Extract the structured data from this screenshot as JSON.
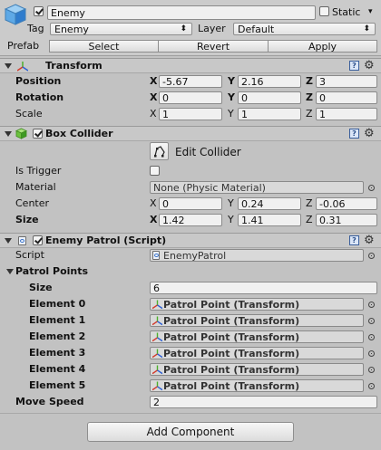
{
  "object": {
    "active": true,
    "name": "Enemy",
    "static_label": "Static",
    "static_checked": false,
    "tag_label": "Tag",
    "tag_value": "Enemy",
    "layer_label": "Layer",
    "layer_value": "Default",
    "prefab_label": "Prefab",
    "prefab_buttons": {
      "select": "Select",
      "revert": "Revert",
      "apply": "Apply"
    }
  },
  "transform": {
    "title": "Transform",
    "position_label": "Position",
    "rotation_label": "Rotation",
    "scale_label": "Scale",
    "axis": {
      "x": "X",
      "y": "Y",
      "z": "Z"
    },
    "position": {
      "x": "-5.67",
      "y": "2.16",
      "z": "3"
    },
    "rotation": {
      "x": "0",
      "y": "0",
      "z": "0"
    },
    "scale": {
      "x": "1",
      "y": "1",
      "z": "1"
    }
  },
  "box_collider": {
    "title": "Box Collider",
    "enabled": true,
    "edit_collider_label": "Edit Collider",
    "is_trigger_label": "Is Trigger",
    "is_trigger_checked": false,
    "material_label": "Material",
    "material_value": "None (Physic Material)",
    "center_label": "Center",
    "center": {
      "x": "0",
      "y": "0.24",
      "z": "-0.06"
    },
    "size_label": "Size",
    "size": {
      "x": "1.42",
      "y": "1.41",
      "z": "0.31"
    }
  },
  "enemy_patrol": {
    "title": "Enemy Patrol (Script)",
    "enabled": true,
    "script_label": "Script",
    "script_value": "EnemyPatrol",
    "patrol_points_label": "Patrol Points",
    "size_label": "Size",
    "size_value": "6",
    "elements": [
      {
        "label": "Element 0",
        "value": "Patrol Point (Transform)"
      },
      {
        "label": "Element 1",
        "value": "Patrol Point (Transform)"
      },
      {
        "label": "Element 2",
        "value": "Patrol Point (Transform)"
      },
      {
        "label": "Element 3",
        "value": "Patrol Point (Transform)"
      },
      {
        "label": "Element 4",
        "value": "Patrol Point (Transform)"
      },
      {
        "label": "Element 5",
        "value": "Patrol Point (Transform)"
      }
    ],
    "move_speed_label": "Move Speed",
    "move_speed_value": "2"
  },
  "footer": {
    "add_component_label": "Add Component"
  },
  "icons": {
    "header": [
      "cube-icon",
      "help-icon",
      "gear-icon"
    ],
    "transform": "transform-icon",
    "collider": "box-collider-icon",
    "script": "script-icon",
    "object_picker": "object-picker-icon",
    "edit_collider": "edit-collider-icon"
  },
  "colors": {
    "background": "#c2c2c2",
    "header": "#c8c8c8",
    "field": "#f0f0f0",
    "axis_x": "#d33b2c",
    "axis_y": "#4caf2a",
    "axis_z": "#2c5fd3"
  }
}
